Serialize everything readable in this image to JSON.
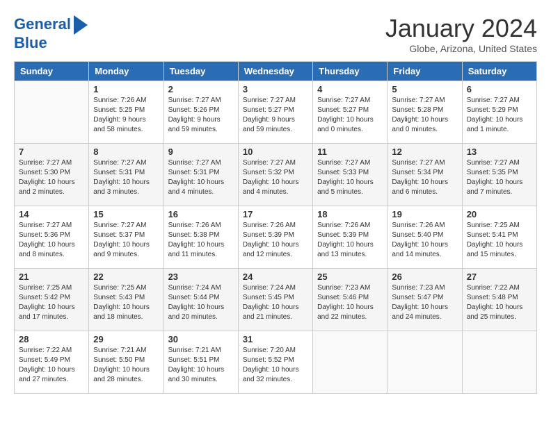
{
  "header": {
    "logo_line1": "General",
    "logo_line2": "Blue",
    "month_title": "January 2024",
    "subtitle": "Globe, Arizona, United States"
  },
  "days_of_week": [
    "Sunday",
    "Monday",
    "Tuesday",
    "Wednesday",
    "Thursday",
    "Friday",
    "Saturday"
  ],
  "weeks": [
    [
      {
        "day": "",
        "info": ""
      },
      {
        "day": "1",
        "info": "Sunrise: 7:26 AM\nSunset: 5:25 PM\nDaylight: 9 hours\nand 58 minutes."
      },
      {
        "day": "2",
        "info": "Sunrise: 7:27 AM\nSunset: 5:26 PM\nDaylight: 9 hours\nand 59 minutes."
      },
      {
        "day": "3",
        "info": "Sunrise: 7:27 AM\nSunset: 5:27 PM\nDaylight: 9 hours\nand 59 minutes."
      },
      {
        "day": "4",
        "info": "Sunrise: 7:27 AM\nSunset: 5:27 PM\nDaylight: 10 hours\nand 0 minutes."
      },
      {
        "day": "5",
        "info": "Sunrise: 7:27 AM\nSunset: 5:28 PM\nDaylight: 10 hours\nand 0 minutes."
      },
      {
        "day": "6",
        "info": "Sunrise: 7:27 AM\nSunset: 5:29 PM\nDaylight: 10 hours\nand 1 minute."
      }
    ],
    [
      {
        "day": "7",
        "info": "Sunrise: 7:27 AM\nSunset: 5:30 PM\nDaylight: 10 hours\nand 2 minutes."
      },
      {
        "day": "8",
        "info": "Sunrise: 7:27 AM\nSunset: 5:31 PM\nDaylight: 10 hours\nand 3 minutes."
      },
      {
        "day": "9",
        "info": "Sunrise: 7:27 AM\nSunset: 5:31 PM\nDaylight: 10 hours\nand 4 minutes."
      },
      {
        "day": "10",
        "info": "Sunrise: 7:27 AM\nSunset: 5:32 PM\nDaylight: 10 hours\nand 4 minutes."
      },
      {
        "day": "11",
        "info": "Sunrise: 7:27 AM\nSunset: 5:33 PM\nDaylight: 10 hours\nand 5 minutes."
      },
      {
        "day": "12",
        "info": "Sunrise: 7:27 AM\nSunset: 5:34 PM\nDaylight: 10 hours\nand 6 minutes."
      },
      {
        "day": "13",
        "info": "Sunrise: 7:27 AM\nSunset: 5:35 PM\nDaylight: 10 hours\nand 7 minutes."
      }
    ],
    [
      {
        "day": "14",
        "info": "Sunrise: 7:27 AM\nSunset: 5:36 PM\nDaylight: 10 hours\nand 8 minutes."
      },
      {
        "day": "15",
        "info": "Sunrise: 7:27 AM\nSunset: 5:37 PM\nDaylight: 10 hours\nand 9 minutes."
      },
      {
        "day": "16",
        "info": "Sunrise: 7:26 AM\nSunset: 5:38 PM\nDaylight: 10 hours\nand 11 minutes."
      },
      {
        "day": "17",
        "info": "Sunrise: 7:26 AM\nSunset: 5:39 PM\nDaylight: 10 hours\nand 12 minutes."
      },
      {
        "day": "18",
        "info": "Sunrise: 7:26 AM\nSunset: 5:39 PM\nDaylight: 10 hours\nand 13 minutes."
      },
      {
        "day": "19",
        "info": "Sunrise: 7:26 AM\nSunset: 5:40 PM\nDaylight: 10 hours\nand 14 minutes."
      },
      {
        "day": "20",
        "info": "Sunrise: 7:25 AM\nSunset: 5:41 PM\nDaylight: 10 hours\nand 15 minutes."
      }
    ],
    [
      {
        "day": "21",
        "info": "Sunrise: 7:25 AM\nSunset: 5:42 PM\nDaylight: 10 hours\nand 17 minutes."
      },
      {
        "day": "22",
        "info": "Sunrise: 7:25 AM\nSunset: 5:43 PM\nDaylight: 10 hours\nand 18 minutes."
      },
      {
        "day": "23",
        "info": "Sunrise: 7:24 AM\nSunset: 5:44 PM\nDaylight: 10 hours\nand 20 minutes."
      },
      {
        "day": "24",
        "info": "Sunrise: 7:24 AM\nSunset: 5:45 PM\nDaylight: 10 hours\nand 21 minutes."
      },
      {
        "day": "25",
        "info": "Sunrise: 7:23 AM\nSunset: 5:46 PM\nDaylight: 10 hours\nand 22 minutes."
      },
      {
        "day": "26",
        "info": "Sunrise: 7:23 AM\nSunset: 5:47 PM\nDaylight: 10 hours\nand 24 minutes."
      },
      {
        "day": "27",
        "info": "Sunrise: 7:22 AM\nSunset: 5:48 PM\nDaylight: 10 hours\nand 25 minutes."
      }
    ],
    [
      {
        "day": "28",
        "info": "Sunrise: 7:22 AM\nSunset: 5:49 PM\nDaylight: 10 hours\nand 27 minutes."
      },
      {
        "day": "29",
        "info": "Sunrise: 7:21 AM\nSunset: 5:50 PM\nDaylight: 10 hours\nand 28 minutes."
      },
      {
        "day": "30",
        "info": "Sunrise: 7:21 AM\nSunset: 5:51 PM\nDaylight: 10 hours\nand 30 minutes."
      },
      {
        "day": "31",
        "info": "Sunrise: 7:20 AM\nSunset: 5:52 PM\nDaylight: 10 hours\nand 32 minutes."
      },
      {
        "day": "",
        "info": ""
      },
      {
        "day": "",
        "info": ""
      },
      {
        "day": "",
        "info": ""
      }
    ]
  ]
}
